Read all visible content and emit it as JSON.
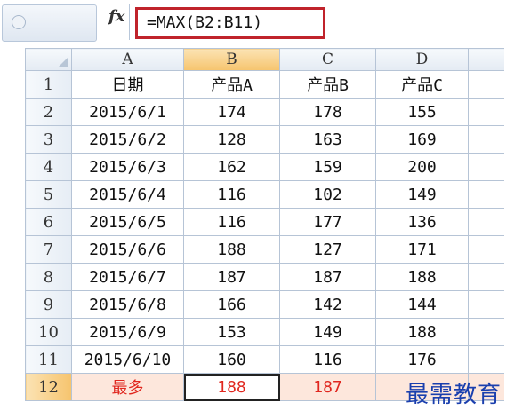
{
  "formula_bar": {
    "fx_label": "fx",
    "formula": "=MAX(B2:B11)"
  },
  "columns": [
    "A",
    "B",
    "C",
    "D"
  ],
  "selected_column": "B",
  "rows": [
    {
      "num": "1",
      "cells": [
        "日期",
        "产品A",
        "产品B",
        "产品C"
      ]
    },
    {
      "num": "2",
      "cells": [
        "2015/6/1",
        "174",
        "178",
        "155"
      ]
    },
    {
      "num": "3",
      "cells": [
        "2015/6/2",
        "128",
        "163",
        "169"
      ]
    },
    {
      "num": "4",
      "cells": [
        "2015/6/3",
        "162",
        "159",
        "200"
      ]
    },
    {
      "num": "5",
      "cells": [
        "2015/6/4",
        "116",
        "102",
        "149"
      ]
    },
    {
      "num": "6",
      "cells": [
        "2015/6/5",
        "116",
        "177",
        "136"
      ]
    },
    {
      "num": "7",
      "cells": [
        "2015/6/6",
        "188",
        "127",
        "171"
      ]
    },
    {
      "num": "8",
      "cells": [
        "2015/6/7",
        "187",
        "187",
        "188"
      ]
    },
    {
      "num": "9",
      "cells": [
        "2015/6/8",
        "166",
        "142",
        "144"
      ]
    },
    {
      "num": "10",
      "cells": [
        "2015/6/9",
        "153",
        "149",
        "188"
      ]
    },
    {
      "num": "11",
      "cells": [
        "2015/6/10",
        "160",
        "116",
        "176"
      ]
    },
    {
      "num": "12",
      "cells": [
        "最多",
        "188",
        "187",
        ""
      ]
    }
  ],
  "active_cell": "B12",
  "watermark": "最需教育",
  "colors": {
    "formula_highlight": "#c0232b",
    "max_row_text": "#e0261e",
    "max_row_fill": "#fde7dc",
    "selected_header": "#f6c46e",
    "watermark": "#1a3fae"
  }
}
